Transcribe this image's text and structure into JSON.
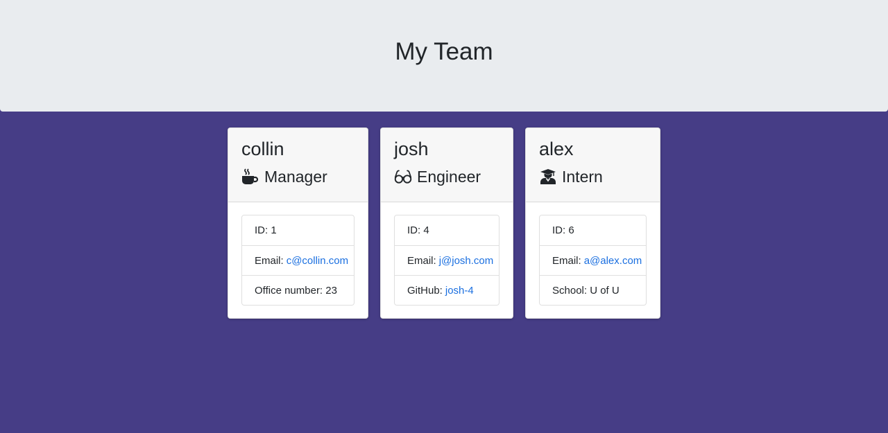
{
  "page": {
    "title": "My Team",
    "colors": {
      "background": "#463d86",
      "header_bg": "#e9ecef",
      "link": "#1a6fe0"
    }
  },
  "employees": [
    {
      "name": "collin",
      "role": "Manager",
      "icon": "coffee-icon",
      "id_label": "ID: 1",
      "email_label": "Email:",
      "email": "c@collin.com",
      "extra_label": "Office number: 23",
      "extra_link": ""
    },
    {
      "name": "josh",
      "role": "Engineer",
      "icon": "glasses-icon",
      "id_label": "ID: 4",
      "email_label": "Email:",
      "email": "j@josh.com",
      "extra_label": "GitHub:",
      "extra_link": "josh-4"
    },
    {
      "name": "alex",
      "role": "Intern",
      "icon": "graduate-icon",
      "id_label": "ID: 6",
      "email_label": "Email:",
      "email": "a@alex.com",
      "extra_label": "School: U of U",
      "extra_link": ""
    }
  ]
}
